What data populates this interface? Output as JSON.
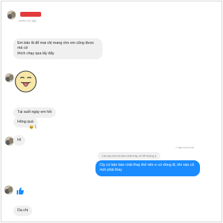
{
  "header": {
    "subtitle": "Active 2m ago"
  },
  "messages": {
    "m1_line1": "Em bảo lã để mai chị mang cho em cũng được mà cứ",
    "m1_line2": "thích chạy qua lấy đấy",
    "m2": "Tại suốt ngày em hỏi",
    "m3": "Hông quá",
    "m3_reaction": "1",
    "m4": "Hi",
    "reply_label": "Bạn trả lời Hà",
    "reply_ref": "Cái này mà tìm bàn chải thay cỏ để không ạ",
    "m5_line1": "Cty có bán bàn chải thay thế nên e cứ dùng đi, khi nào cũ",
    "m5_line2": "mới phải thay",
    "m6": "Dạ chị"
  },
  "colors": {
    "outgoing": "#1a8cff",
    "incoming": "#f1f0f0",
    "like": "#1a8cff"
  },
  "icons": {
    "sticker": "tongue-out-emoji-sticker",
    "like": "thumbs-up-icon",
    "reaction": "laughing-emoji"
  }
}
